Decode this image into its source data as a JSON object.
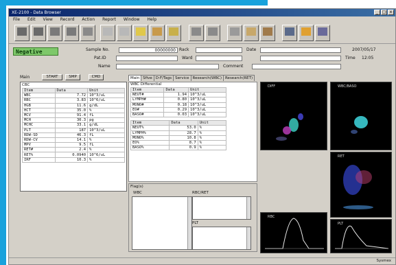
{
  "window": {
    "title": "XE-2100 - Data Browser",
    "close": "x",
    "min": "_",
    "max": "□"
  },
  "menu": [
    "File",
    "Edit",
    "View",
    "Record",
    "Action",
    "Report",
    "Window",
    "Help"
  ],
  "toolbar": [
    "",
    "",
    "",
    "",
    "",
    "",
    "",
    "",
    "",
    "",
    "",
    "",
    "",
    "",
    "",
    "",
    "",
    ""
  ],
  "result": "Negative",
  "header": {
    "sample_no_label": "Sample No.",
    "sample_no": "00000000",
    "rack_label": "Rack",
    "date_label": "Date",
    "date": "2007/05/17",
    "pat_id_label": "Pat.ID",
    "ward_label": "Ward",
    "time_label": "Time",
    "time": "12:05",
    "name_label": "Name",
    "comment_label": "Comment"
  },
  "mode_row": {
    "main_label": "Main",
    "start": "START",
    "smp": "SMP",
    "cmd": "CMD"
  },
  "cbc": {
    "title": "CBC",
    "headers": [
      "Item",
      "Data",
      "Unit"
    ],
    "rows": [
      [
        "WBC",
        "7.72",
        "10^3/uL"
      ],
      [
        "RBC",
        "3.83",
        "10^6/uL"
      ],
      [
        "HGB",
        "11.6",
        "g/dL"
      ],
      [
        "HCT",
        "35.0",
        "%"
      ],
      [
        "MCV",
        "91.4",
        "fL"
      ],
      [
        "MCH",
        "30.3",
        "pg"
      ],
      [
        "MCHC",
        "33.1",
        "g/dL"
      ],
      [
        "PLT",
        "187",
        "10^3/uL"
      ],
      [
        "RDW-SD",
        "46.3",
        "fL"
      ],
      [
        "RDW-CV",
        "14.1",
        "%"
      ],
      [
        "MPV",
        "9.5",
        "fL"
      ],
      [
        "RET#",
        "2.4",
        "%"
      ],
      [
        "RET%",
        "0.0940",
        "10^6/uL"
      ],
      [
        "IRF",
        "10.3",
        "%"
      ]
    ]
  },
  "tabs": [
    "Main",
    "Sfive",
    "D-F/Tags",
    "Service",
    "Research(WBC)",
    "Research(RET)"
  ],
  "diff_abs": {
    "title": "WBC Differential",
    "headers": [
      "Item",
      "Data",
      "Unit"
    ],
    "rows": [
      [
        "NEUT#",
        "1.94",
        "10^3/uL"
      ],
      [
        "LYMPH#",
        "0.80",
        "10^3/uL"
      ],
      [
        "MONO#",
        "0.18",
        "10^3/uL"
      ],
      [
        "EO#",
        "0.29",
        "10^3/uL"
      ],
      [
        "BASO#",
        "0.03",
        "10^3/uL"
      ]
    ]
  },
  "diff_pct": {
    "headers": [
      "Item",
      "Data",
      "Unit"
    ],
    "rows": [
      [
        "NEUT%",
        "53.0",
        "%"
      ],
      [
        "LYMPH%",
        "28.7",
        "%"
      ],
      [
        "MONO%",
        "10.8",
        "%"
      ],
      [
        "EO%",
        "8.7",
        "%"
      ],
      [
        "BASO%",
        "0.9",
        "%"
      ]
    ]
  },
  "flags": {
    "title": "Flag(s)",
    "wbc": "WBC",
    "rbc_ret": "RBC/RET",
    "plt": "PLT"
  },
  "scatter": {
    "diff": "DIFF",
    "wbc_baso": "WBC/BASO",
    "ret": "RET",
    "rbc": "RBC",
    "plt": "PLT"
  },
  "status": {
    "right": "Sysmex"
  },
  "colors": {
    "accent": "#18a2dc",
    "negative_bg": "#7ec86a",
    "window_bg": "#d4d0c8"
  }
}
